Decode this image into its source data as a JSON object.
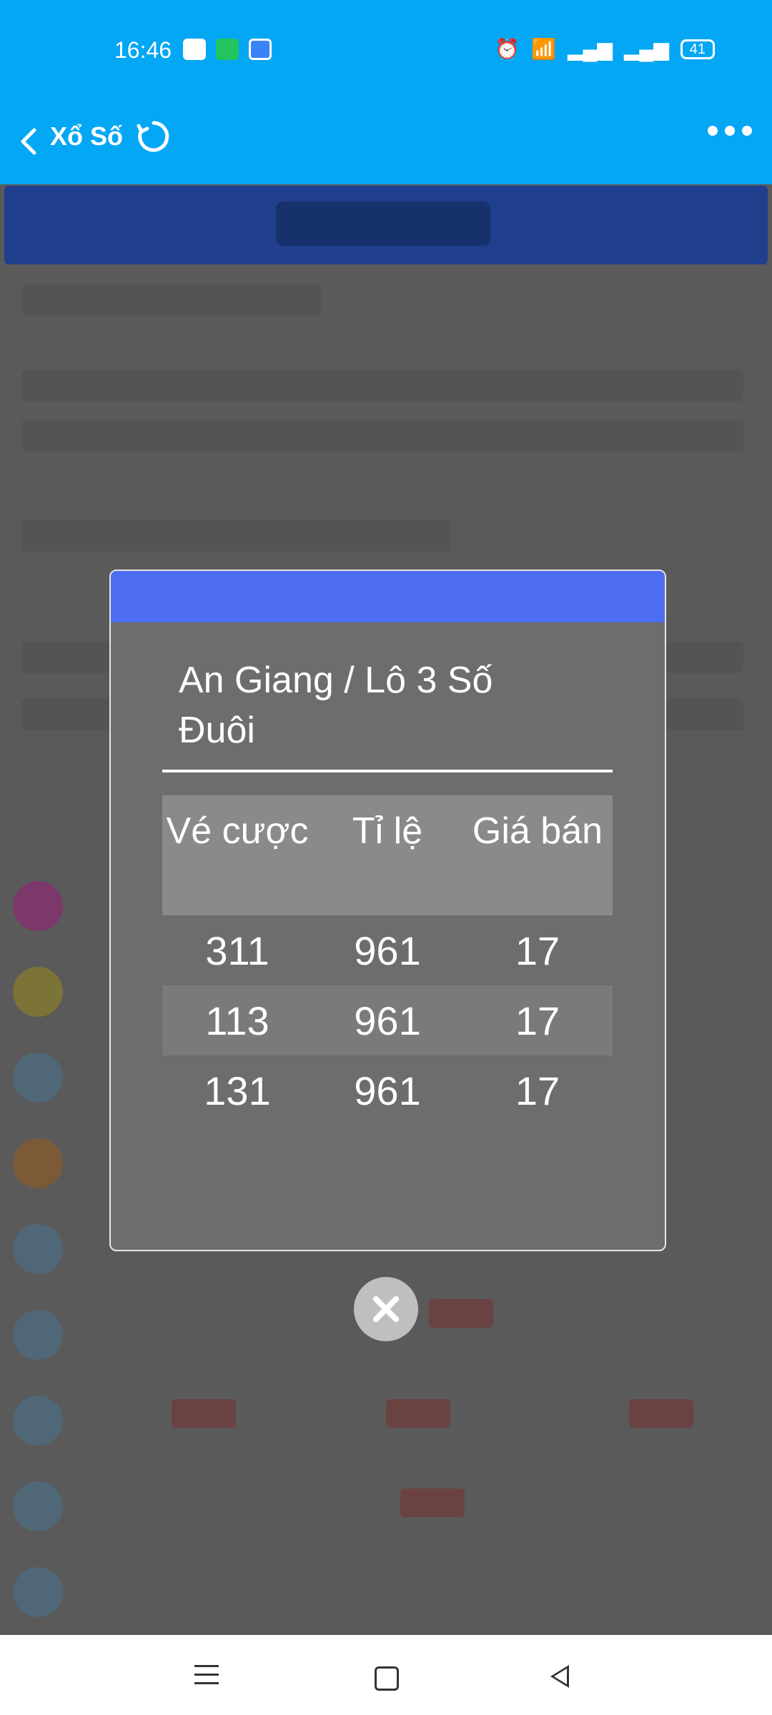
{
  "status_bar": {
    "time": "16:46",
    "battery": "41"
  },
  "app_bar": {
    "title": "Xổ Số"
  },
  "modal": {
    "title": "An Giang / Lô 3 Số Đuôi",
    "columns": [
      "Vé cược",
      "Tỉ lệ",
      "Giá bán"
    ],
    "rows": [
      [
        "311",
        "961",
        "17"
      ],
      [
        "113",
        "961",
        "17"
      ],
      [
        "131",
        "961",
        "17"
      ]
    ]
  }
}
